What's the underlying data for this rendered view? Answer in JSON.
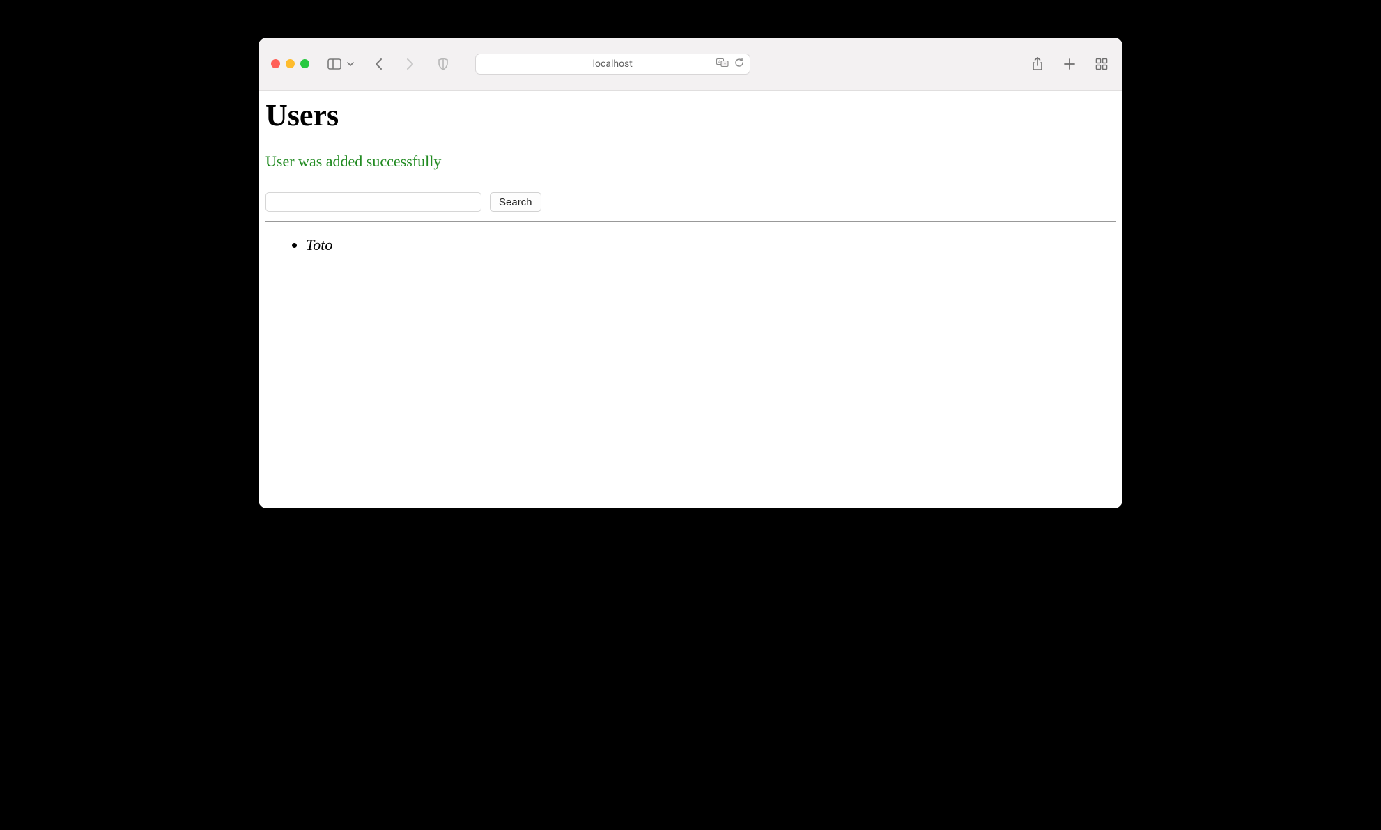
{
  "browser": {
    "address": "localhost"
  },
  "page": {
    "title": "Users",
    "success_message": "User was added successfully",
    "search": {
      "button_label": "Search",
      "value": ""
    },
    "users": [
      "Toto"
    ]
  }
}
